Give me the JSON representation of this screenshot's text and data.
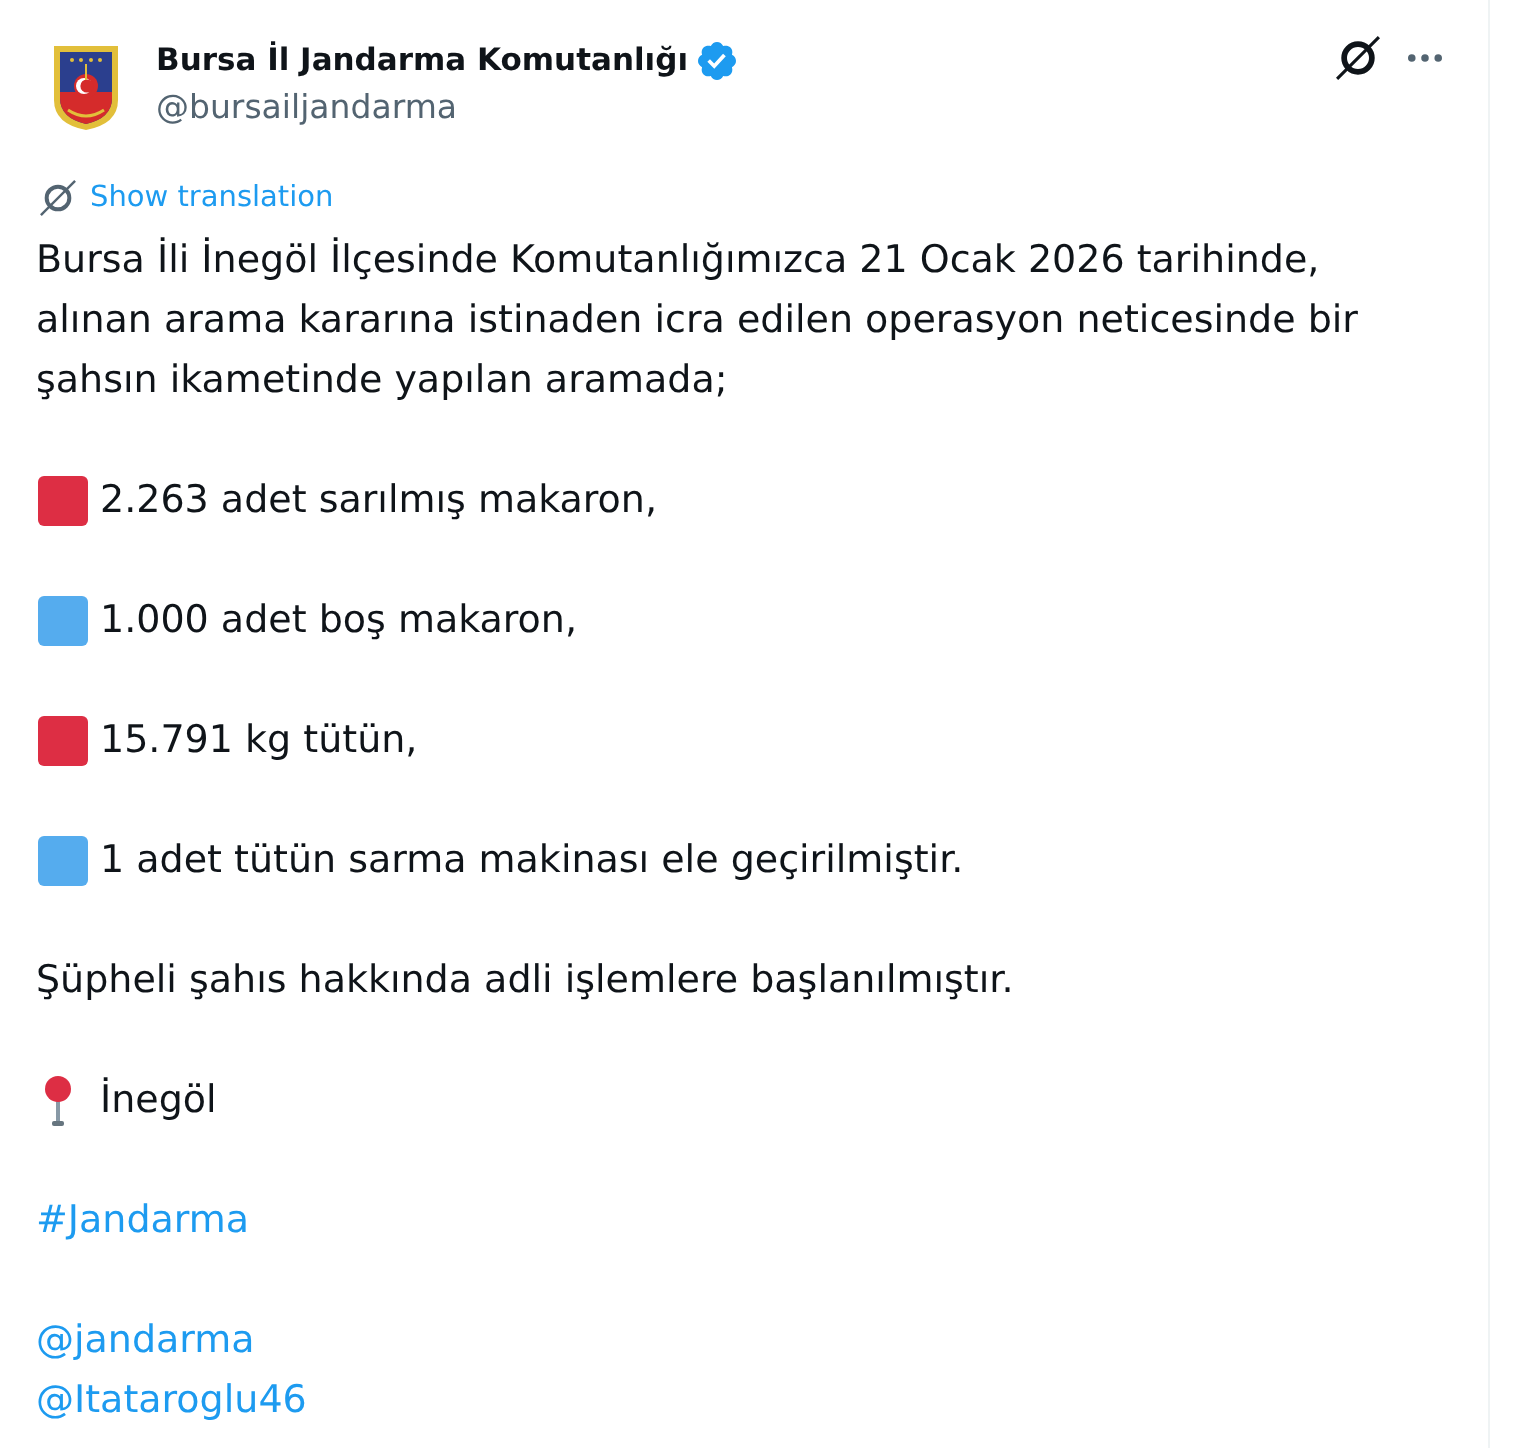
{
  "author": {
    "name": "Bursa İl Jandarma Komutanlığı",
    "verified": true,
    "handle": "@bursailjandarma"
  },
  "translate_link": "Show translation",
  "body": [
    {
      "kind": "text",
      "text": "Bursa İli İnegöl İlçesinde Komutanlığımızca 21 Ocak 2026 tarihinde, alınan arama kararına istinaden icra edilen operasyon neticesinde bir şahsın ikametinde yapılan aramada;"
    },
    {
      "kind": "item",
      "color": "#dd2e44",
      "text": "2.263 adet sarılmış makaron,"
    },
    {
      "kind": "item",
      "color": "#55acee",
      "text": "1.000 adet boş makaron,"
    },
    {
      "kind": "item",
      "color": "#dd2e44",
      "text": "15.791 kg tütün,"
    },
    {
      "kind": "item",
      "color": "#55acee",
      "text": "1 adet tütün sarma makinası ele geçirilmiştir."
    },
    {
      "kind": "text",
      "text": "Şüpheli şahıs hakkında adli işlemlere başlanılmıştır."
    },
    {
      "kind": "location",
      "text": "İnegöl"
    },
    {
      "kind": "hashtag",
      "text": "#Jandarma"
    },
    {
      "kind": "mentions",
      "items": [
        "@jandarma",
        "@Itataroglu46"
      ]
    }
  ]
}
